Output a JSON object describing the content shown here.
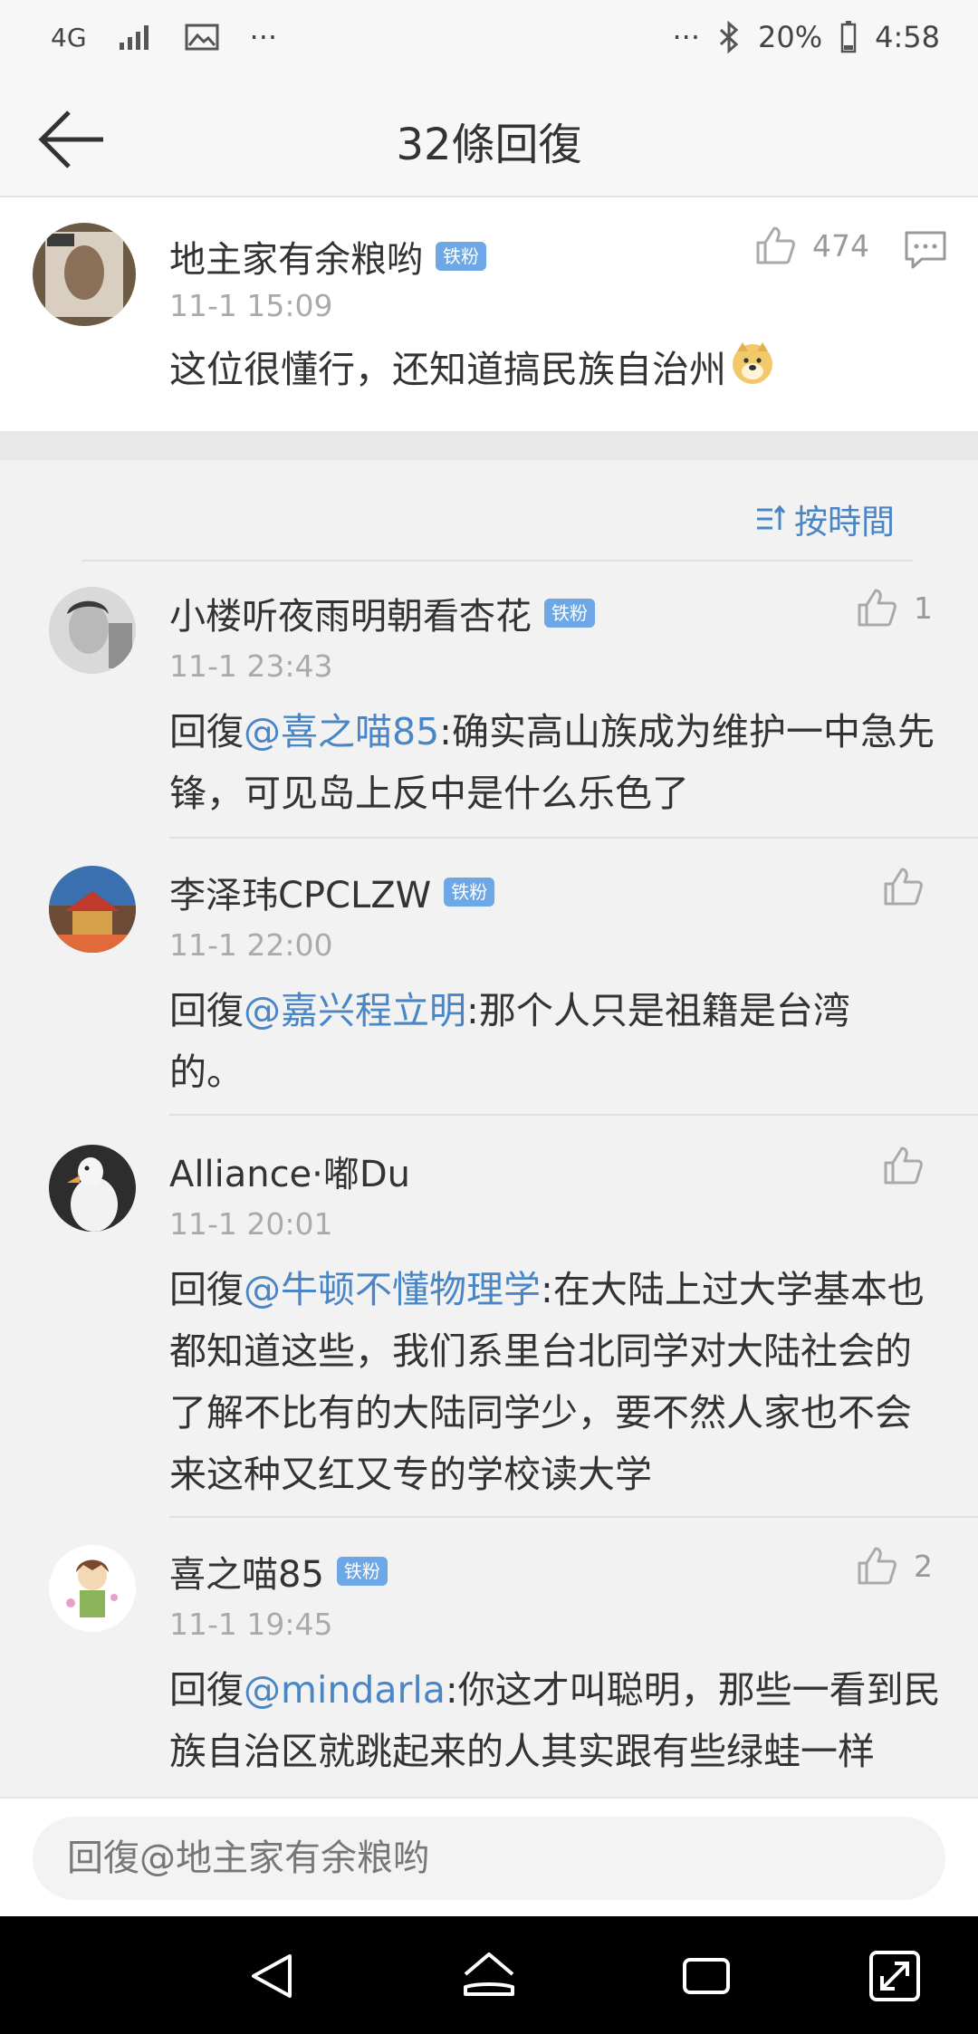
{
  "status_bar": {
    "network": "4G",
    "more": "···",
    "battery": "20%",
    "time": "4:58"
  },
  "header": {
    "title": "32條回復"
  },
  "main_comment": {
    "user": "地主家有余粮哟",
    "badge": "铁粉",
    "time": "11-1 15:09",
    "text": "这位很懂行，还知道搞民族自治州",
    "likes": "474"
  },
  "sort": {
    "label": "按時間"
  },
  "replies": [
    {
      "user": "小楼听夜雨明朝看杏花",
      "badge": "铁粉",
      "time": "11-1 23:43",
      "prefix": "回復",
      "mention": "@喜之喵85",
      "body": ":确实高山族成为维护一中急先锋，可见岛上反中是什么乐色了",
      "likes": "1"
    },
    {
      "user": "李泽玮CPCLZW",
      "badge": "铁粉",
      "time": "11-1 22:00",
      "prefix": "回復",
      "mention": "@嘉兴程立明",
      "body": ":那个人只是祖籍是台湾的。",
      "likes": ""
    },
    {
      "user": "Alliance·嘟Du",
      "badge": "",
      "time": "11-1 20:01",
      "prefix": "回復",
      "mention": "@牛顿不懂物理学",
      "body": ":在大陆上过大学基本也都知道这些，我们系里台北同学对大陆社会的了解不比有的大陆同学少，要不然人家也不会来这种又红又专的学校读大学",
      "likes": ""
    },
    {
      "user": "喜之喵85",
      "badge": "铁粉",
      "time": "11-1 19:45",
      "prefix": "回復",
      "mention": "@mindarla",
      "body": ":你这才叫聪明，那些一看到民族自治区就跳起来的人其实跟有些绿蛙一样",
      "likes": "2"
    }
  ],
  "input": {
    "placeholder": "回復@地主家有余粮哟"
  },
  "colors": {
    "accent": "#4a86c6",
    "badge": "#6da7e6"
  }
}
